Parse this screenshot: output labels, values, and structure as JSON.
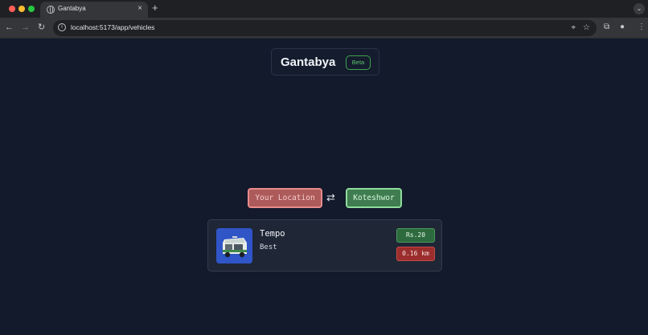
{
  "browser": {
    "tab_title": "Gantabya",
    "tab_close": "×",
    "new_tab": "+",
    "tab_search": "⌄",
    "url": "localhost:5173/app/vehicles",
    "back": "←",
    "forward": "→",
    "reload": "↻",
    "site_info": "i",
    "location_icon": "⌖",
    "bookmark_icon": "☆",
    "extensions_icon": "⧉",
    "profile_icon": "●",
    "menu_icon": "⋮"
  },
  "header": {
    "brand": "Gantabya",
    "badge": "Beta"
  },
  "route": {
    "from": "Your Location",
    "to": "Koteshwor",
    "swap_icon": "⇄"
  },
  "vehicles": [
    {
      "name": "Tempo",
      "tag": "Best",
      "price": "Rs.20",
      "distance": "0.16 km",
      "image_icon": "tempo-icon"
    }
  ],
  "colors": {
    "background": "#121a2b",
    "accent_green": "#3fa34d",
    "accent_red": "#ad5a5a",
    "thumb_blue": "#2f55c7"
  }
}
